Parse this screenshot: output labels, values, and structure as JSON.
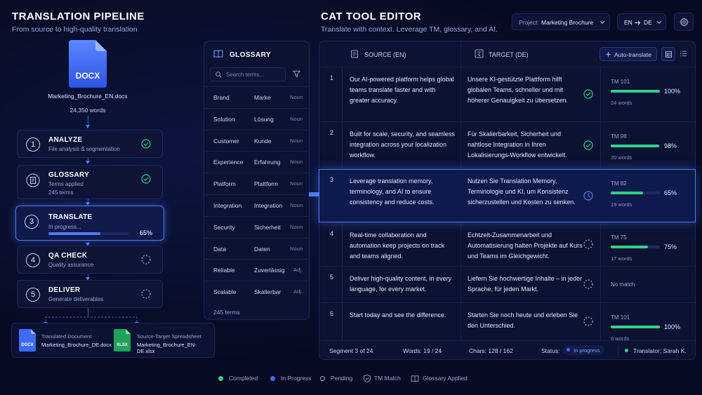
{
  "pipeline": {
    "title": "TRANSLATION PIPELINE",
    "subtitle": "From source to high-quality translation",
    "source_file": {
      "badge": "DOCX",
      "name": "Marketing_Brochure_EN.docx",
      "words": "24,350 words"
    },
    "stages": [
      {
        "num": "1",
        "name": "ANALYZE",
        "desc": "File analysis & segmentation",
        "status": "completed"
      },
      {
        "num": "2",
        "name": "GLOSSARY",
        "desc": "Terms applied",
        "desc2": "245 terms",
        "status": "completed"
      },
      {
        "num": "3",
        "name": "TRANSLATE",
        "desc": "In progress...",
        "progress": 65,
        "progress_label": "65%",
        "status": "in-progress"
      },
      {
        "num": "4",
        "name": "QA CHECK",
        "desc": "Quality assurance",
        "status": "pending"
      },
      {
        "num": "5",
        "name": "DELIVER",
        "desc": "Generate deliverables",
        "status": "pending"
      }
    ],
    "outputs": [
      {
        "badge": "DOCX",
        "label": "Translated Document",
        "file": "Marketing_Brochure_DE.docx",
        "color": "#3d6bff"
      },
      {
        "badge": "XLSX",
        "label": "Source-Target Spreadsheet",
        "file": "Marketing_Brochure_EN-DE.xlsx",
        "color": "#1fa25a"
      }
    ]
  },
  "glossary": {
    "title": "GLOSSARY",
    "search_placeholder": "Search terms...",
    "terms": [
      {
        "src": "Brand",
        "tgt": "Marke",
        "pos": "Noun"
      },
      {
        "src": "Solution",
        "tgt": "Lösung",
        "pos": "Noun"
      },
      {
        "src": "Customer",
        "tgt": "Kunde",
        "pos": "Noun"
      },
      {
        "src": "Experience",
        "tgt": "Erfahrung",
        "pos": "Noun"
      },
      {
        "src": "Platform",
        "tgt": "Plattform",
        "pos": "Noun"
      },
      {
        "src": "Integration",
        "tgt": "Integration",
        "pos": "Noun"
      },
      {
        "src": "Security",
        "tgt": "Sicherheit",
        "pos": "Noun"
      },
      {
        "src": "Data",
        "tgt": "Daten",
        "pos": "Noun"
      },
      {
        "src": "Reliable",
        "tgt": "Zuverlässig",
        "pos": "Adj."
      },
      {
        "src": "Scalable",
        "tgt": "Skalierbar",
        "pos": "Adj."
      }
    ],
    "footer": "245 terms"
  },
  "editor": {
    "title": "CAT TOOL EDITOR",
    "subtitle": "Translate with context. Leverage TM, glossary, and AI.",
    "project_label": "Project:",
    "project_value": "Marketing Brochure",
    "lang_src": "EN",
    "lang_tgt": "DE",
    "source_header": "SOURCE (EN)",
    "target_header": "TARGET (DE)",
    "auto_translate": "Auto-translate",
    "segments": [
      {
        "num": "1",
        "src": "Our AI-powered platform helps global teams translate faster and with greater accuracy.",
        "tgt": "Unsere KI-gestützte Plattform hilft globalen Teams, schneller und mit höherer Genauigkeit zu übersetzen.",
        "status": "completed",
        "tm": "TM 101",
        "pct": 100,
        "pct_label": "100%",
        "words": "24 words"
      },
      {
        "num": "2",
        "src": "Built for scale, security, and seamless integration across your localization workflow.",
        "tgt": "Für Skalierbarkeit, Sicherheit und nahtlose Integration in Ihren Lokalisierungs-Workflow entwickelt.",
        "status": "completed",
        "tm": "TM 98",
        "pct": 98,
        "pct_label": "98%",
        "words": "20 words"
      },
      {
        "num": "3",
        "src": "Leverage translation memory, terminology, and AI to ensure consistency and reduce costs.",
        "tgt": "Nutzen Sie Translation Memory, Terminologie und KI, um Konsistenz sicherzustellen und Kosten zu senken.",
        "status": "in-progress",
        "tm": "TM 82",
        "pct": 65,
        "pct_label": "65%",
        "words": "19 words"
      },
      {
        "num": "4",
        "src": "Real-time collaboration and automation keep projects on track and teams aligned.",
        "tgt": "Echtzeit-Zusammenarbeit und Automatisierung halten Projekte auf Kurs und Teams im Gleichgewicht.",
        "status": "pending",
        "tm": "TM 75",
        "pct": 75,
        "pct_label": "75%",
        "words": "17 words"
      },
      {
        "num": "5",
        "src": "Deliver high-quality content, in every language, for every market.",
        "tgt": "Liefern Sie hochwertige Inhalte – in jeder Sprache, für jeden Markt.",
        "status": "pending",
        "tm": "",
        "no_match": "No match"
      },
      {
        "num": "6",
        "src": "Start today and see the difference.",
        "tgt": "Starten Sie noch heute und erleben Sie den Unterschied.",
        "status": "pending",
        "tm": "TM 101",
        "pct": 100,
        "pct_label": "100%",
        "words": "6 words"
      }
    ],
    "footer": {
      "segment": "Segment 3 of 24",
      "words": "Words: 19 / 24",
      "chars": "Chars: 128 / 162",
      "status_label": "Status:",
      "status_value": "In progress",
      "translator": "Translator: Sarah K."
    }
  },
  "legend": [
    {
      "label": "Completed",
      "color": "#2fd08a",
      "kind": "dot"
    },
    {
      "label": "In Progress",
      "color": "#3d6bff",
      "kind": "dot"
    },
    {
      "label": "Pending",
      "color": "#9aa4d6",
      "kind": "ring"
    },
    {
      "label": "TM Match",
      "kind": "shield-icon"
    },
    {
      "label": "Glossary Applied",
      "kind": "book-icon"
    }
  ],
  "colors": {
    "accent": "#4f7cff",
    "success": "#2fd08a",
    "background": "#070b22"
  }
}
